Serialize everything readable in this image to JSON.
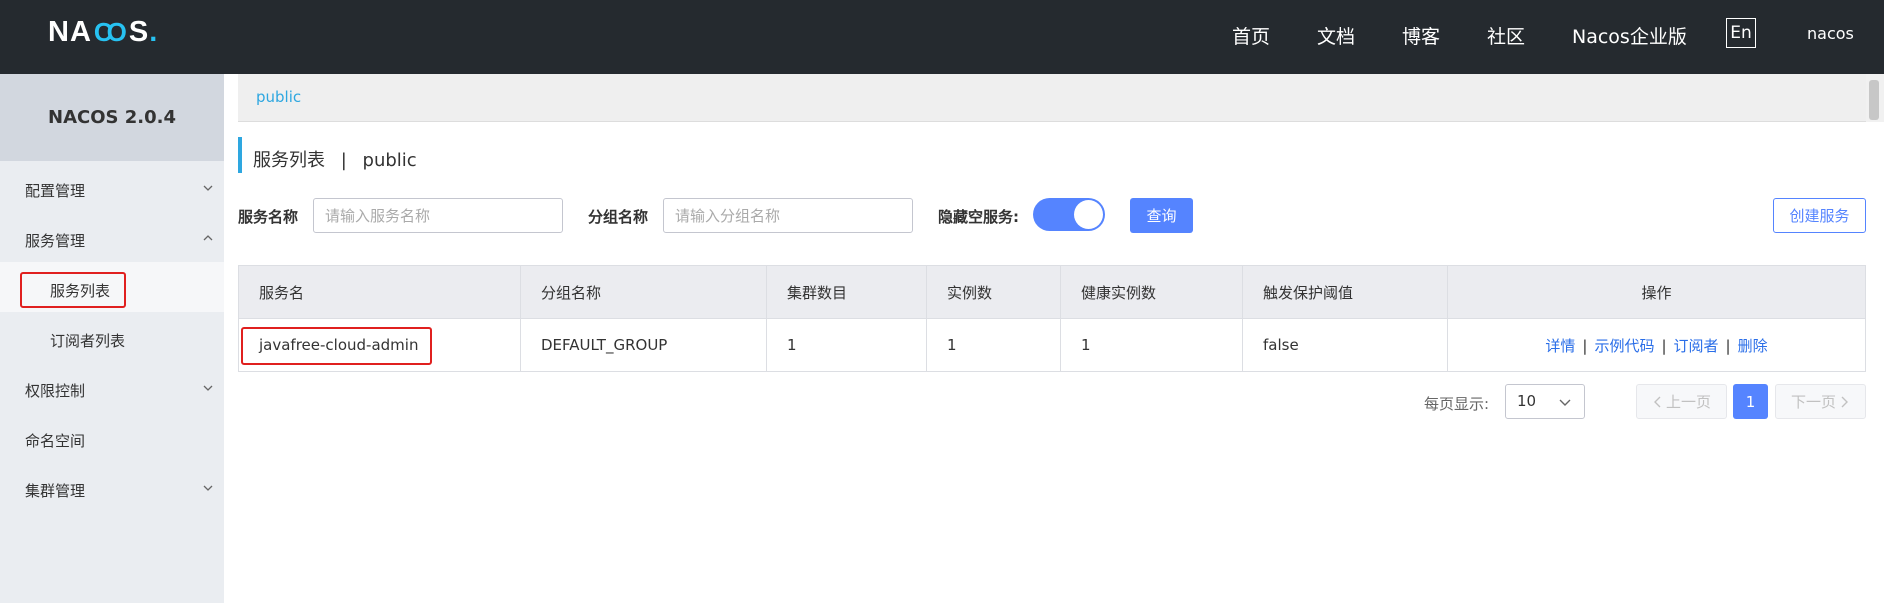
{
  "header": {
    "logo": {
      "pre": "NA",
      "mid": "CO",
      "post": "S",
      "dot": ".",
      "accent": "#27c2f2"
    },
    "nav": [
      "首页",
      "文档",
      "博客",
      "社区",
      "Nacos企业版"
    ],
    "lang": "En",
    "user": "nacos"
  },
  "sidebar": {
    "title": "NACOS 2.0.4",
    "items": [
      {
        "label": "配置管理",
        "icon": "chevron-down-icon"
      },
      {
        "label": "服务管理",
        "icon": "chevron-up-icon"
      },
      {
        "label": "服务列表"
      },
      {
        "label": "订阅者列表"
      },
      {
        "label": "权限控制",
        "icon": "chevron-down-icon"
      },
      {
        "label": "命名空间"
      },
      {
        "label": "集群管理",
        "icon": "chevron-down-icon"
      }
    ]
  },
  "main": {
    "breadcrumb": "public",
    "title": "服务列表",
    "title_sep": "|",
    "title_ns": "public",
    "filters": {
      "service_name_label": "服务名称",
      "service_name_placeholder": "请输入服务名称",
      "group_name_label": "分组名称",
      "group_name_placeholder": "请输入分组名称",
      "hide_empty_label": "隐藏空服务:",
      "hide_empty_on": true,
      "query_button": "查询",
      "create_button": "创建服务"
    },
    "table": {
      "headers": [
        "服务名",
        "分组名称",
        "集群数目",
        "实例数",
        "健康实例数",
        "触发保护阈值",
        "操作"
      ],
      "rows": [
        {
          "service": "javafree-cloud-admin",
          "group": "DEFAULT_GROUP",
          "clusters": "1",
          "instances": "1",
          "healthy": "1",
          "threshold": "false"
        }
      ],
      "actions": [
        "详情",
        "示例代码",
        "订阅者",
        "删除"
      ],
      "action_sep": "|"
    },
    "pagination": {
      "page_size_label": "每页显示:",
      "page_size": "10",
      "prev": "上一页",
      "current": "1",
      "next": "下一页"
    }
  },
  "colors": {
    "primary": "#5584ff",
    "link": "#2a6ee8",
    "highlight": "#e0201f",
    "header_bg": "#252a2f"
  }
}
